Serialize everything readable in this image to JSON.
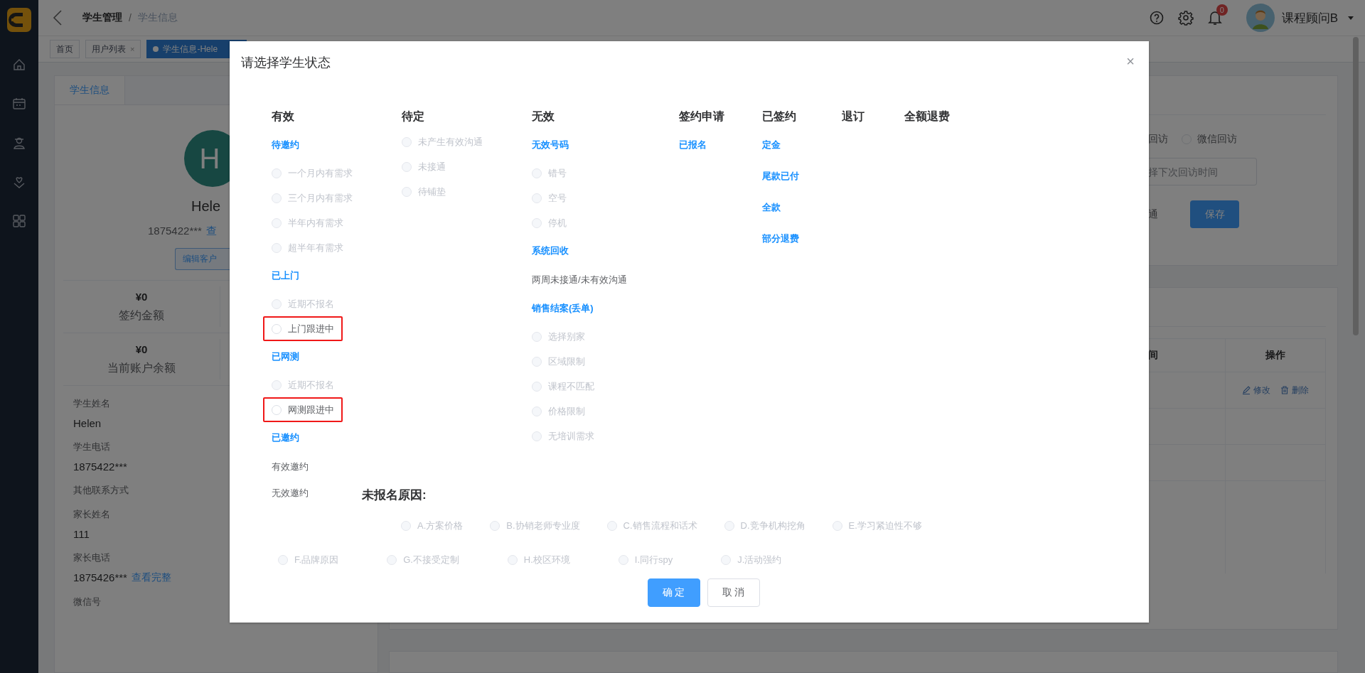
{
  "header": {
    "breadcrumb": [
      "学生管理",
      "学生信息"
    ],
    "separator": "/",
    "notification_count": "0",
    "user_name": "课程顾问B"
  },
  "tabs": [
    {
      "label": "首页",
      "selected": false
    },
    {
      "label": "用户列表",
      "selected": false,
      "close": "×"
    },
    {
      "label": "学生信息-Hele",
      "selected": true
    }
  ],
  "student_panel": {
    "tab": "学生信息",
    "avatar_letter": "H",
    "name": "Hele",
    "phone": "1875422***",
    "phone_link": "查",
    "edit_button": "编辑客户",
    "stats": [
      {
        "value": "¥0",
        "label": "签约金额"
      },
      {
        "value": "¥0",
        "label": "当前账户余额"
      }
    ],
    "fields": [
      {
        "label": "学生姓名",
        "value": "Helen"
      },
      {
        "label": "学生电话",
        "value": "1875422***"
      },
      {
        "label": "其他联系方式"
      },
      {
        "label": "家长姓名",
        "value": "111"
      },
      {
        "label": "家长电话",
        "value": "1875426***",
        "link": "查看完整"
      },
      {
        "label": "微信号"
      }
    ]
  },
  "followup_panel": {
    "method_label": "回访",
    "radio": {
      "label": "微信回访",
      "selected": false
    },
    "date_placeholder": "择下次回访时间",
    "status_label": "通",
    "save_button": "保存"
  },
  "records_panel": {
    "columns": [
      "间",
      "操作"
    ],
    "rows": [
      {
        "actions": [
          "修改",
          "删除"
        ]
      }
    ]
  },
  "modal": {
    "title": "请选择学生状态",
    "close": "×",
    "columns": [
      {
        "title": "有效",
        "items": [
          {
            "kind": "group",
            "label": "待邀约"
          },
          {
            "kind": "radio",
            "label": "一个月内有需求",
            "selected": false,
            "disabled": true,
            "highlighted": false
          },
          {
            "kind": "radio",
            "label": "三个月内有需求",
            "selected": false,
            "disabled": true,
            "highlighted": false
          },
          {
            "kind": "radio",
            "label": "半年内有需求",
            "selected": false,
            "disabled": true,
            "highlighted": false
          },
          {
            "kind": "radio",
            "label": "超半年有需求",
            "selected": false,
            "disabled": true,
            "highlighted": false
          },
          {
            "kind": "group",
            "label": "已上门"
          },
          {
            "kind": "radio",
            "label": "近期不报名",
            "selected": false,
            "disabled": true,
            "highlighted": false
          },
          {
            "kind": "radio",
            "label": "上门跟进中",
            "selected": false,
            "disabled": false,
            "highlighted": true
          },
          {
            "kind": "group",
            "label": "已网测"
          },
          {
            "kind": "radio",
            "label": "近期不报名",
            "selected": false,
            "disabled": true,
            "highlighted": false
          },
          {
            "kind": "radio",
            "label": "网测跟进中",
            "selected": false,
            "disabled": false,
            "highlighted": true
          },
          {
            "kind": "group",
            "label": "已邀约"
          },
          {
            "kind": "text",
            "label": "有效邀约"
          },
          {
            "kind": "text",
            "label": "无效邀约"
          }
        ]
      },
      {
        "title": "待定",
        "items": [
          {
            "kind": "radio",
            "label": "未产生有效沟通",
            "selected": false,
            "disabled": true,
            "highlighted": false
          },
          {
            "kind": "radio",
            "label": "未接通",
            "selected": false,
            "disabled": true,
            "highlighted": false
          },
          {
            "kind": "radio",
            "label": "待铺垫",
            "selected": false,
            "disabled": true,
            "highlighted": false
          }
        ]
      },
      {
        "title": "无效",
        "items": [
          {
            "kind": "group",
            "label": "无效号码"
          },
          {
            "kind": "radio",
            "label": "错号",
            "selected": false,
            "disabled": true,
            "highlighted": false
          },
          {
            "kind": "radio",
            "label": "空号",
            "selected": false,
            "disabled": true,
            "highlighted": false
          },
          {
            "kind": "radio",
            "label": "停机",
            "selected": false,
            "disabled": true,
            "highlighted": false
          },
          {
            "kind": "group",
            "label": "系统回收"
          },
          {
            "kind": "text",
            "label": "两周未接通/未有效沟通"
          },
          {
            "kind": "group",
            "label": "销售结案(丢单)"
          },
          {
            "kind": "radio",
            "label": "选择别家",
            "selected": false,
            "disabled": true,
            "highlighted": false
          },
          {
            "kind": "radio",
            "label": "区域限制",
            "selected": false,
            "disabled": true,
            "highlighted": false
          },
          {
            "kind": "radio",
            "label": "课程不匹配",
            "selected": false,
            "disabled": true,
            "highlighted": false
          },
          {
            "kind": "radio",
            "label": "价格限制",
            "selected": false,
            "disabled": true,
            "highlighted": false
          },
          {
            "kind": "radio",
            "label": "无培训需求",
            "selected": false,
            "disabled": true,
            "highlighted": false
          }
        ]
      },
      {
        "title": "签约申请",
        "items": [
          {
            "kind": "group",
            "label": "已报名"
          }
        ]
      },
      {
        "title": "已签约",
        "items": [
          {
            "kind": "group",
            "label": "定金"
          },
          {
            "kind": "group",
            "label": "尾款已付"
          },
          {
            "kind": "group",
            "label": "全款"
          },
          {
            "kind": "group",
            "label": "部分退费"
          }
        ]
      },
      {
        "title": "退订"
      },
      {
        "title": "全额退费"
      }
    ],
    "reasons_title": "未报名原因:",
    "reason_rows": [
      [
        {
          "label": "A.方案价格",
          "selected": false,
          "disabled": true
        },
        {
          "label": "B.协销老师专业度",
          "selected": false,
          "disabled": true
        },
        {
          "label": "C.销售流程和话术",
          "selected": false,
          "disabled": true
        },
        {
          "label": "D.竞争机构挖角",
          "selected": false,
          "disabled": true
        },
        {
          "label": "E.学习紧迫性不够",
          "selected": false,
          "disabled": true
        }
      ],
      [
        {
          "label": "F.品牌原因",
          "selected": false,
          "disabled": true
        },
        {
          "label": "G.不接受定制",
          "selected": false,
          "disabled": true
        },
        {
          "label": "H.校区环境",
          "selected": false,
          "disabled": true
        },
        {
          "label": "I.同行spy",
          "selected": false,
          "disabled": true
        },
        {
          "label": "J.活动强约",
          "selected": false,
          "disabled": true
        }
      ]
    ],
    "buttons": [
      {
        "label": "确 定",
        "kind": "primary"
      },
      {
        "label": "取 消",
        "kind": "default"
      }
    ]
  }
}
